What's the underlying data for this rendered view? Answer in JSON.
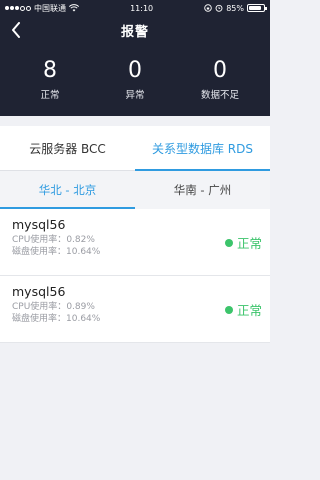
{
  "status_bar": {
    "carrier": "中国联通",
    "time": "11:10",
    "battery": "85%",
    "battery_level": 0.85
  },
  "nav": {
    "title": "报警",
    "back_icon": "chevron-left-icon"
  },
  "stats": [
    {
      "value": "8",
      "label": "正常"
    },
    {
      "value": "0",
      "label": "异常"
    },
    {
      "value": "0",
      "label": "数据不足"
    }
  ],
  "tabs": [
    {
      "label": "云服务器 BCC",
      "active": false
    },
    {
      "label": "关系型数据库 RDS",
      "active": true
    }
  ],
  "regions": [
    {
      "label": "华北 - 北京",
      "active": true
    },
    {
      "label": "华南 - 广州",
      "active": false
    }
  ],
  "instances": [
    {
      "name": "mysql56",
      "cpu_label": "CPU使用率：",
      "cpu_value": "0.82%",
      "disk_label": "磁盘使用率：",
      "disk_value": "10.64%",
      "status": "正常"
    },
    {
      "name": "mysql56",
      "cpu_label": "CPU使用率：",
      "cpu_value": "0.89%",
      "disk_label": "磁盘使用率：",
      "disk_value": "10.64%",
      "status": "正常"
    }
  ],
  "colors": {
    "header_bg": "#1f2333",
    "accent": "#2f9be0",
    "ok": "#3cc46b"
  }
}
